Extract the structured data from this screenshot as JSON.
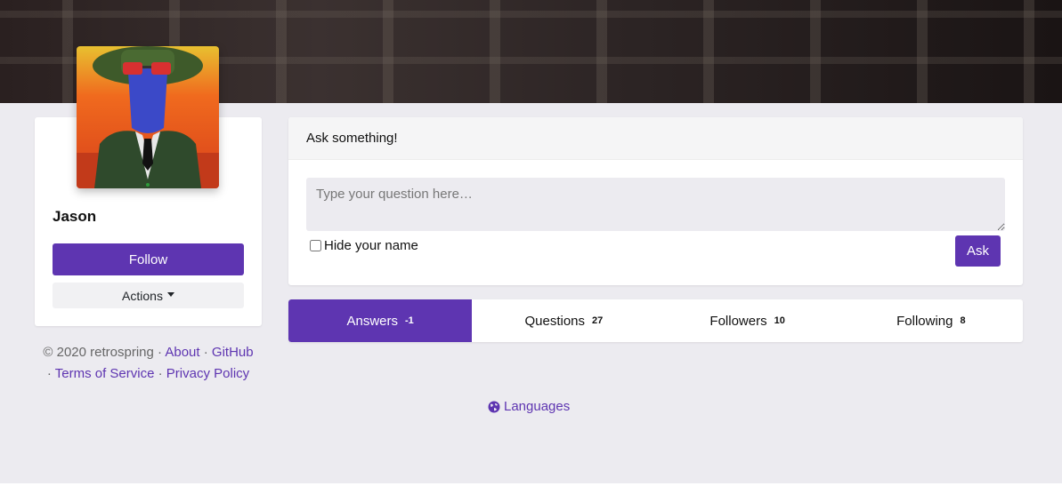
{
  "profile": {
    "name": "Jason",
    "follow_label": "Follow",
    "actions_label": "Actions",
    "avatar_icon": "avatar-portrait"
  },
  "footer": {
    "copyright": "© 2020 retrospring",
    "sep": "·",
    "about": "About",
    "github": "GitHub",
    "terms": "Terms of Service",
    "privacy": "Privacy Policy"
  },
  "ask": {
    "title": "Ask something!",
    "placeholder": "Type your question here…",
    "hide_name_label": "Hide your name",
    "ask_label": "Ask"
  },
  "tabs": [
    {
      "label": "Answers",
      "count": "-1",
      "active": true
    },
    {
      "label": "Questions",
      "count": "27",
      "active": false
    },
    {
      "label": "Followers",
      "count": "10",
      "active": false
    },
    {
      "label": "Following",
      "count": "8",
      "active": false
    }
  ],
  "languages": {
    "label": "Languages",
    "icon": "globe-icon"
  },
  "colors": {
    "accent": "#5e35b1",
    "background": "#ecebf0"
  }
}
